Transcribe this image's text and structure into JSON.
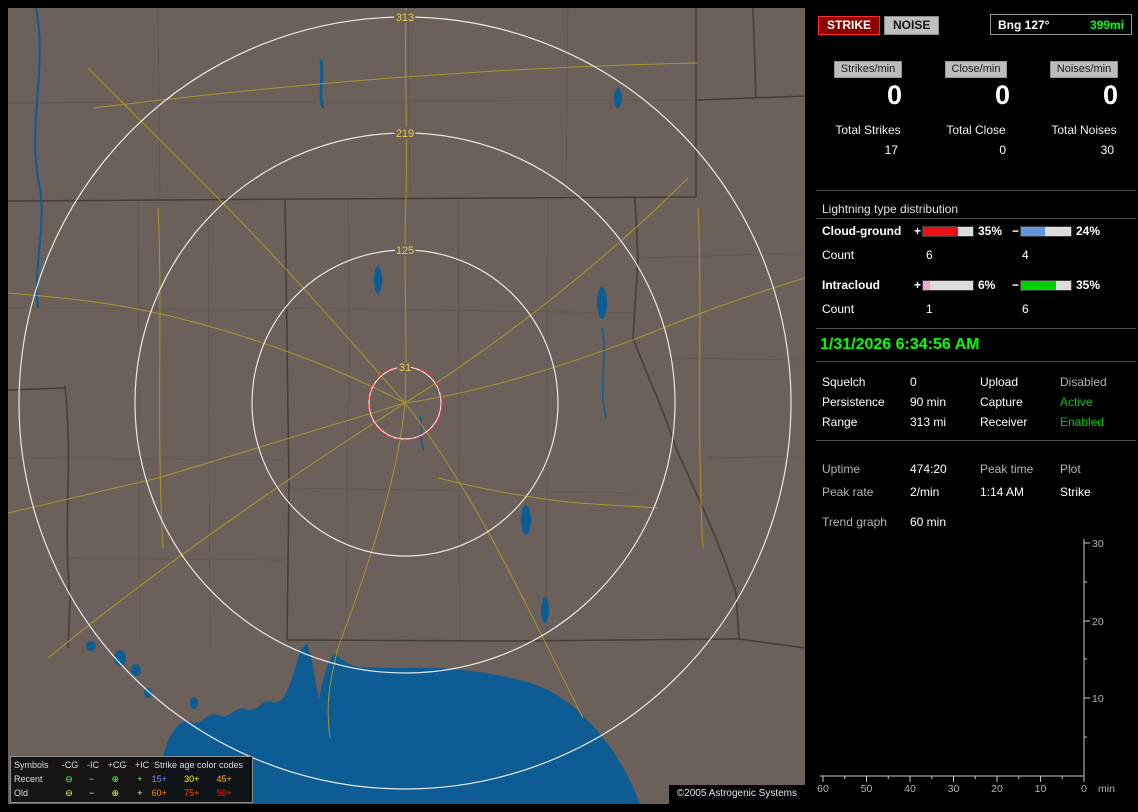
{
  "map": {
    "ring_labels": [
      "313",
      "219",
      "125",
      "31"
    ],
    "copyright": "©2005 Astrogenic Systems",
    "legend": {
      "symbols_title": "Symbols",
      "col_headers": [
        "-CG",
        "-IC",
        "+CG",
        "+IC"
      ],
      "age_title": "Strike age color codes",
      "symbol_glyphs": [
        "⊖",
        "−",
        "⊕",
        "+"
      ],
      "rows": [
        {
          "label": "Recent",
          "symbol_color": "#59ff59",
          "ages": [
            {
              "text": "15+",
              "color": "#6e8cff"
            },
            {
              "text": "30+",
              "color": "#ffff00"
            },
            {
              "text": "45+",
              "color": "#ffb400"
            }
          ]
        },
        {
          "label": "Old",
          "symbol_color": "#ffff55",
          "ages": [
            {
              "text": "60+",
              "color": "#ff8c00"
            },
            {
              "text": "75+",
              "color": "#ff5000"
            },
            {
              "text": "90+",
              "color": "#ff1414"
            }
          ]
        }
      ]
    }
  },
  "panel": {
    "strike_button": "STRIKE",
    "noise_button": "NOISE",
    "bearing": {
      "label": "Bng 127°",
      "distance": "399mi",
      "distance_color": "#00ff00"
    },
    "rates": [
      {
        "label": "Strikes/min",
        "value": "0"
      },
      {
        "label": "Close/min",
        "value": "0"
      },
      {
        "label": "Noises/min",
        "value": "0"
      }
    ],
    "totals": [
      {
        "label": "Total Strikes",
        "value": "17"
      },
      {
        "label": "Total Close",
        "value": "0"
      },
      {
        "label": "Total Noises",
        "value": "30"
      }
    ],
    "distribution": {
      "title": "Lightning type distribution",
      "rows": [
        {
          "label": "Cloud-ground",
          "plus": "+",
          "minus": "−",
          "pos_pct": "35%",
          "neg_pct": "24%",
          "pos_fill": 70,
          "neg_fill": 48,
          "pos_color": "#ee1111",
          "neg_color": "#5f96e0",
          "count_label": "Count",
          "pos_count": "6",
          "neg_count": "4"
        },
        {
          "label": "Intracloud",
          "plus": "+",
          "minus": "−",
          "pos_pct": "6%",
          "neg_pct": "35%",
          "pos_fill": 13,
          "neg_fill": 70,
          "pos_color": "#f0a6d2",
          "neg_color": "#00d200",
          "count_label": "Count",
          "pos_count": "1",
          "neg_count": "6"
        }
      ]
    },
    "datetime": {
      "text": "1/31/2026 6:34:56 AM",
      "color": "#00ff00"
    },
    "settings": [
      {
        "key1": "Squelch",
        "val1": "0",
        "key2": "Upload",
        "val2": "Disabled",
        "val2_color": "#b4b4b4"
      },
      {
        "key1": "Persistence",
        "val1": "90 min",
        "key2": "Capture",
        "val2": "Active",
        "val2_color": "#00cc00"
      },
      {
        "key1": "Range",
        "val1": "313 mi",
        "key2": "Receiver",
        "val2": "Enabled",
        "val2_color": "#00cc00"
      }
    ],
    "stats": {
      "row1": [
        {
          "text": "Uptime",
          "color": "#b4b4b4"
        },
        {
          "text": "474:20",
          "color": "#ffffff"
        },
        {
          "text": "Peak time",
          "color": "#b4b4b4"
        },
        {
          "text": "Plot",
          "color": "#b4b4b4"
        }
      ],
      "row2": [
        {
          "text": "Peak rate",
          "color": "#b4b4b4"
        },
        {
          "text": "2/min",
          "color": "#ffffff"
        },
        {
          "text": "1:14 AM",
          "color": "#ffffff"
        },
        {
          "text": "Strike",
          "color": "#ffffff"
        }
      ]
    },
    "trend": {
      "label": "Trend graph",
      "value": "60 min"
    },
    "graph": {
      "y_ticks": [
        "30",
        "20",
        "10"
      ],
      "x_ticks": [
        "60",
        "50",
        "40",
        "30",
        "20",
        "10",
        "0"
      ],
      "x_unit": "min"
    }
  }
}
